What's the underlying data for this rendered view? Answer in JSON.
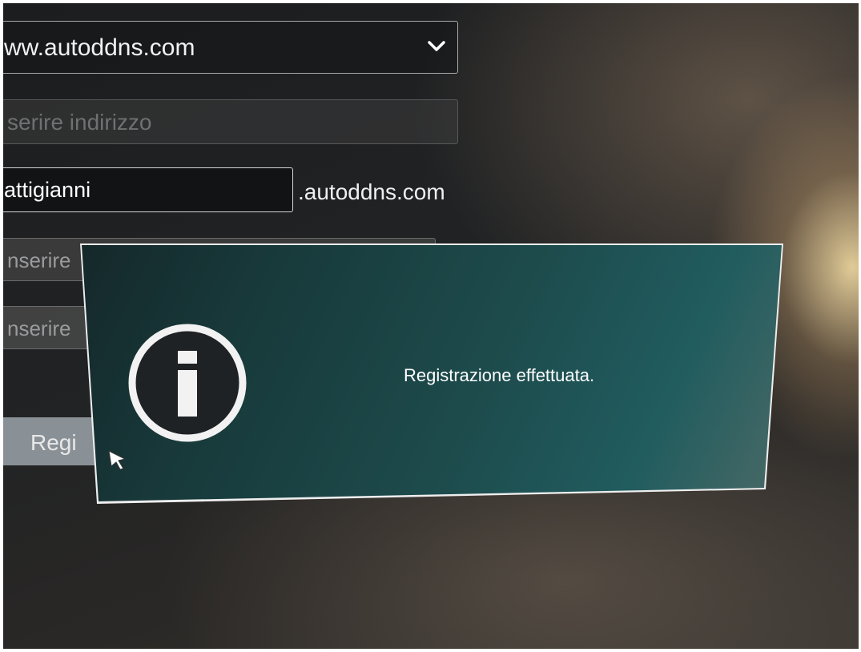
{
  "form": {
    "ddns_server": "ww.autoddns.com",
    "address_placeholder": "serire indirizzo",
    "hostname_value": "attigianni",
    "domain_suffix": ".autoddns.com",
    "username_placeholder": "nserire",
    "password_placeholder": "nserire",
    "register_label": "Regi"
  },
  "dialog": {
    "message": "Registrazione effettuata.",
    "icon": "info-icon"
  },
  "icons": {
    "dropdown": "chevron-down-icon",
    "pointer": "mouse-cursor-icon"
  },
  "colors": {
    "dialog_background": "#1d4a4b",
    "dialog_border": "#eeeeee",
    "screen_background": "#202224"
  }
}
